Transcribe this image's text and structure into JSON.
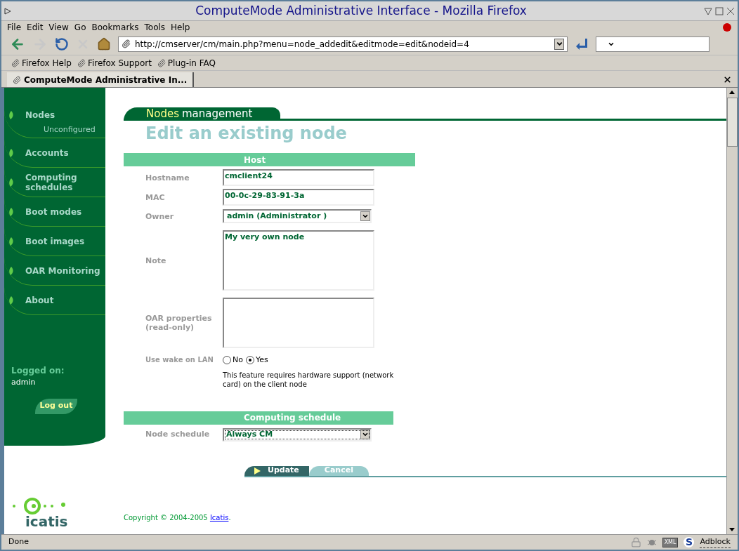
{
  "window": {
    "title": "ComputeMode Administrative Interface - Mozilla Firefox"
  },
  "menu": [
    "File",
    "Edit",
    "View",
    "Go",
    "Bookmarks",
    "Tools",
    "Help"
  ],
  "toolbar": {
    "url": "http://cmserver/cm/main.php?menu=node_addedit&editmode=edit&nodeid=4",
    "back_disabled": false,
    "forward_disabled": true,
    "stop_disabled": true
  },
  "bookmarks": [
    "Firefox Help",
    "Firefox Support",
    "Plug-in FAQ"
  ],
  "tabs": [
    {
      "label": "ComputeMode Administrative In...",
      "selected": true
    }
  ],
  "sidebar": {
    "items": [
      {
        "label": "Nodes",
        "children": [
          {
            "label": "Unconfigured"
          }
        ]
      },
      {
        "label": "Accounts"
      },
      {
        "label": "Computing schedules"
      },
      {
        "label": "Boot modes"
      },
      {
        "label": "Boot images"
      },
      {
        "label": "OAR Monitoring"
      },
      {
        "label": "About"
      }
    ],
    "logged_on_label": "Logged on:",
    "user": "admin",
    "logout": "Log out"
  },
  "page": {
    "section_highlight": "Nodes",
    "section_rest": "management",
    "heading": "Edit an existing node",
    "host": {
      "title": "Host",
      "fields": [
        {
          "kind": "text",
          "label": "Hostname",
          "value": "cmclient24"
        },
        {
          "kind": "text",
          "label": "MAC",
          "value": "00-0c-29-83-91-3a"
        },
        {
          "kind": "select",
          "label": "Owner",
          "value": "admin (Administrator )"
        },
        {
          "kind": "textarea",
          "label": "Note",
          "value": "My very own node"
        },
        {
          "kind": "textarea",
          "label": "OAR properties (read-only)"
        }
      ]
    },
    "wake": {
      "label": "Use wake on LAN",
      "options": [
        {
          "label": "No",
          "selected": false
        },
        {
          "label": "Yes",
          "selected": true
        }
      ],
      "help": "This feature requires hardware support (network card) on the client node"
    },
    "schedule": {
      "title": "Computing schedule",
      "label": "Node schedule",
      "value": "Always CM"
    },
    "buttons": [
      "Update",
      "Cancel"
    ],
    "footer": {
      "copyright": "Copyright © 2004-2005 ",
      "link": "Icatis",
      "end": ".",
      "logo": "icatis"
    }
  },
  "status_bar": {
    "text": "Done",
    "xml": "XML",
    "s": "S",
    "adblock": "Adblock"
  }
}
